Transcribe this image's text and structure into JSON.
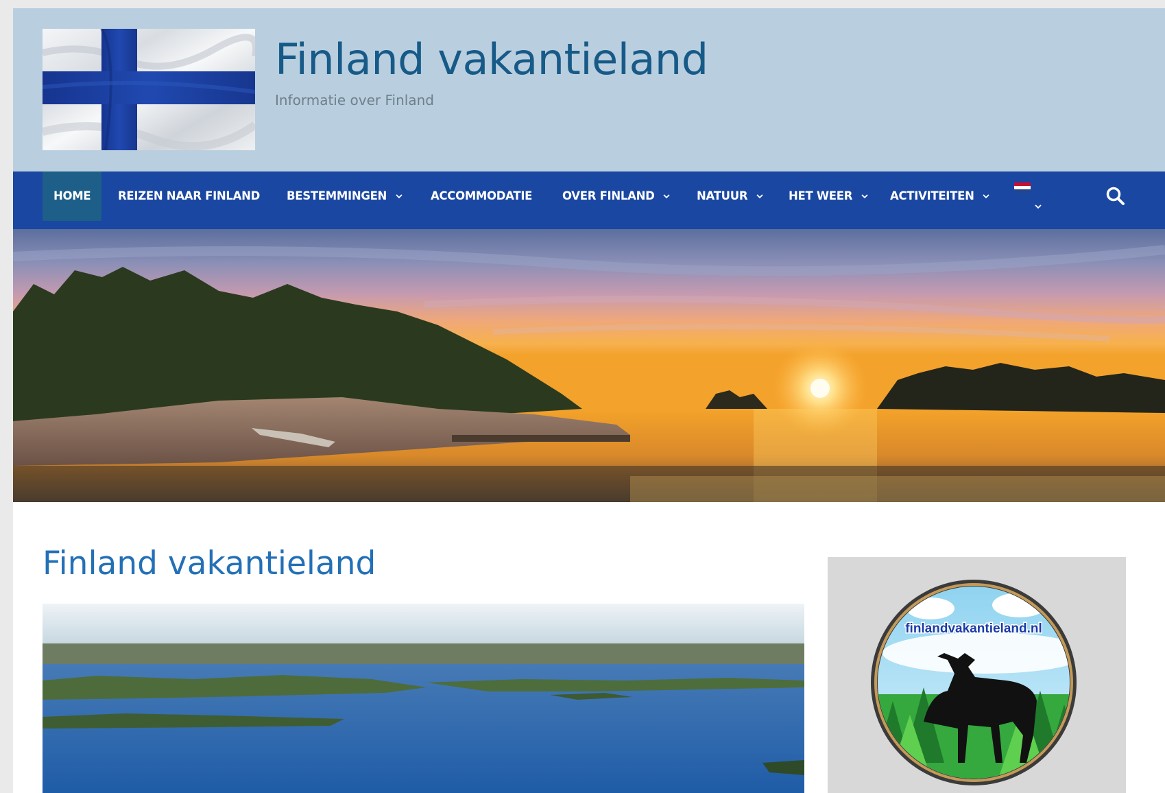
{
  "header": {
    "site_title": "Finland vakantieland",
    "tagline": "Informatie over Finland",
    "background_color": "#b9cfdf",
    "title_color": "#175a87"
  },
  "nav": {
    "background_color": "#1a47a1",
    "active_color": "#1d5f88",
    "items": [
      {
        "label": "HOME",
        "active": true,
        "has_dropdown": false
      },
      {
        "label": "REIZEN NAAR FINLAND",
        "has_dropdown": false
      },
      {
        "label": "BESTEMMINGEN",
        "has_dropdown": true
      },
      {
        "label": "ACCOMMODATIE",
        "has_dropdown": false
      },
      {
        "label": "OVER FINLAND",
        "has_dropdown": true
      },
      {
        "label": "NATUUR",
        "has_dropdown": true
      },
      {
        "label": "HET WEER",
        "has_dropdown": true
      },
      {
        "label": "ACTIVITEITEN",
        "has_dropdown": true
      }
    ],
    "language_icon": "dutch-flag-icon",
    "search_icon": "search-icon"
  },
  "hero": {
    "description_icon": "sunset-lake-banner-image"
  },
  "main": {
    "title": "Finland vakantieland",
    "title_color": "#2370b6"
  },
  "sidebar": {
    "logo_text": "finlandvakantieland.nl"
  }
}
